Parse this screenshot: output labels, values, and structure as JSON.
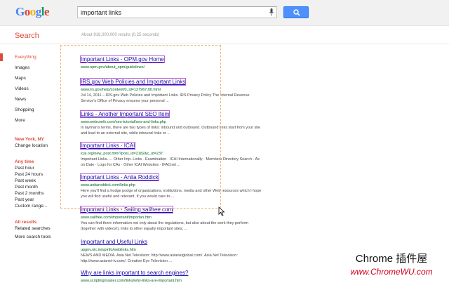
{
  "header": {
    "logo_letters": [
      "G",
      "o",
      "o",
      "g",
      "l",
      "e"
    ],
    "query": "important links",
    "brand_colors": {
      "blue": "#4285f4",
      "red": "#db4437",
      "yellow": "#f4b400",
      "green": "#0f9d58",
      "accent": "#4d90fe"
    }
  },
  "search_title": "Search",
  "stats": "About 916,000,000 results (0.25 seconds)",
  "nav": {
    "items": [
      "Everything",
      "Images",
      "Maps",
      "Videos",
      "News",
      "Shopping",
      "More"
    ],
    "active": "Everything",
    "location": {
      "title": "New York, NY",
      "change": "Change location"
    },
    "time": {
      "title": "Any time",
      "items": [
        "Past hour",
        "Past 24 hours",
        "Past week",
        "Past month",
        "Past 2 months",
        "Past year",
        "Custom range..."
      ]
    },
    "results": {
      "title": "All results",
      "items": [
        "Related searches",
        "More search tools"
      ]
    }
  },
  "results": [
    {
      "title": "Important Links - OPM.gov Home",
      "url": "www.opm.gov/about_opm/guidelines/",
      "snippet": ""
    },
    {
      "title": "IRS.gov Web Policies and Important Links",
      "url": "www.irs.gov/help/content/0,,id=127967,00.html",
      "snippet": "Jul 14, 2011 – IRS.gov Web Policies and Important Links. IRS Privacy Policy The Internal Revenue Service's Office of Privacy ensures your personal ..."
    },
    {
      "title": "Links - Another Important SEO Item",
      "url": "www.webconfs.com/seo-tutorial/seo-and-links.php",
      "snippet": "In layman's terms, there are two types of links: inbound and outbound. Outbound links start from your site and lead to an external site, while inbound links or ..."
    },
    {
      "title": "Important Links - ICAI",
      "url": "icai.org/new_post.html?post_id=2182&c_id=237",
      "snippet": "Important Links. ... Other Imp. Links · Examination · ICAI Internationally · Members Directory Search · As on Date · Logo for CAs · Other ICAI Websites · IFACnet ..."
    },
    {
      "title": "Important Links - Anita Roddick",
      "url": "www.anitaroddick.com/links.php",
      "snippet": "Here you'll find a hodge podge of organizations, institutions, media and other Web resources which I hope you will find useful and relevant. If you would care to ..."
    },
    {
      "title": "Important Links - Sailing sailfree.com",
      "url": "www.sailfree.com/important/importan.htm",
      "snippet": "You can find there information not only about the regulations, but also about the work they perform (together with videos!), links to other equally important sites, ..."
    },
    {
      "title": "Important and Useful Links",
      "url": "upgov.nic.in/upinfo/weblinks.htm",
      "snippet": "NEWS AND MEDIA. Asia Net Television: http://www.asianetglobal.com/. Asia Net Television: http://www.asianet-tv.com/. Creative Eye Television ..."
    },
    {
      "title": "Why are links important to search engines?",
      "url": "www.scriptingmaster.com/links/why-links-are-important.htm",
      "snippet": ""
    }
  ],
  "watermark": {
    "line1": "Chrome 插件屋",
    "line2": "www.ChromeWU.com"
  }
}
